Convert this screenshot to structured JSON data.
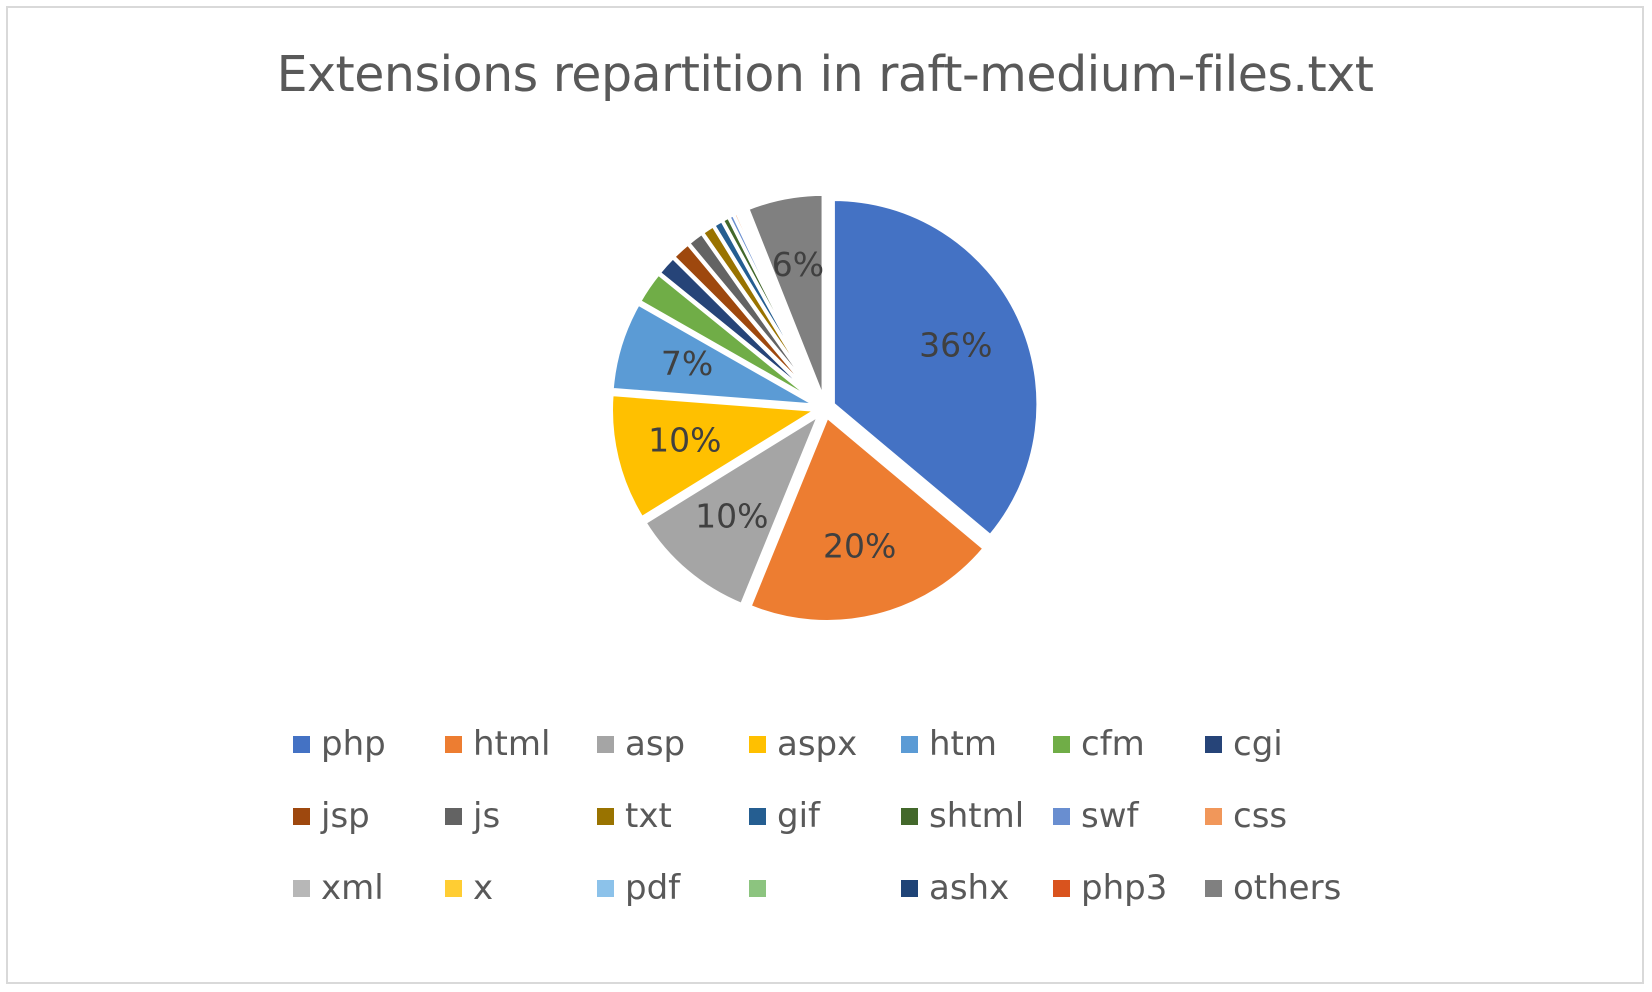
{
  "chart_data": {
    "type": "pie",
    "title": "Extensions repartition in raft-medium-files.txt",
    "xlabel": "",
    "ylabel": "",
    "legend_position": "bottom",
    "grid": false,
    "exploded": true,
    "categories": [
      "php",
      "html",
      "asp",
      "aspx",
      "htm",
      "cfm",
      "cgi",
      "jsp",
      "js",
      "txt",
      "gif",
      "shtml",
      "swf",
      "css",
      "xml",
      "x",
      "pdf",
      "",
      "ashx",
      "php3",
      "others"
    ],
    "values": [
      36,
      20,
      10,
      10,
      7,
      2.6,
      1.6,
      1.5,
      1.3,
      1.0,
      0.75,
      0.55,
      0.4,
      0.3,
      0.22,
      0.16,
      0.12,
      0.09,
      0.07,
      0.05,
      6
    ],
    "data_labels": [
      "36%",
      "20%",
      "10%",
      "10%",
      "7%",
      "",
      "",
      "",
      "",
      "",
      "",
      "",
      "",
      "",
      "",
      "",
      "",
      "",
      "",
      "",
      "6%"
    ],
    "colors": [
      "#4472C4",
      "#ED7D31",
      "#A5A5A5",
      "#FFC000",
      "#5B9BD5",
      "#70AD47",
      "#264478",
      "#9E480E",
      "#636363",
      "#997300",
      "#255E91",
      "#43682B",
      "#698ED0",
      "#F1975A",
      "#B7B7B7",
      "#FFCD33",
      "#8CC2EA",
      "#8CC47F",
      "#1F4477",
      "#D9531E",
      "#808080"
    ]
  },
  "legend": {
    "rows": [
      [
        {
          "label": "php",
          "color": "#4472C4"
        },
        {
          "label": "html",
          "color": "#ED7D31"
        },
        {
          "label": "asp",
          "color": "#A5A5A5"
        },
        {
          "label": "aspx",
          "color": "#FFC000"
        },
        {
          "label": "htm",
          "color": "#5B9BD5"
        },
        {
          "label": "cfm",
          "color": "#70AD47"
        },
        {
          "label": "cgi",
          "color": "#264478"
        }
      ],
      [
        {
          "label": "jsp",
          "color": "#9E480E"
        },
        {
          "label": "js",
          "color": "#636363"
        },
        {
          "label": "txt",
          "color": "#997300"
        },
        {
          "label": "gif",
          "color": "#255E91"
        },
        {
          "label": "shtml",
          "color": "#43682B"
        },
        {
          "label": "swf",
          "color": "#698ED0"
        },
        {
          "label": "css",
          "color": "#F1975A"
        }
      ],
      [
        {
          "label": "xml",
          "color": "#B7B7B7"
        },
        {
          "label": "x",
          "color": "#FFCD33"
        },
        {
          "label": "pdf",
          "color": "#8CC2EA"
        },
        {
          "label": "",
          "color": "#8CC47F"
        },
        {
          "label": "ashx",
          "color": "#1F4477"
        },
        {
          "label": "php3",
          "color": "#D9531E"
        },
        {
          "label": "others",
          "color": "#808080"
        }
      ]
    ]
  },
  "theme": {
    "background": "#FFFFFF",
    "border": "#D9D9D9",
    "title_color": "#595959",
    "label_color": "#404040",
    "legend_text_color": "#595959"
  }
}
